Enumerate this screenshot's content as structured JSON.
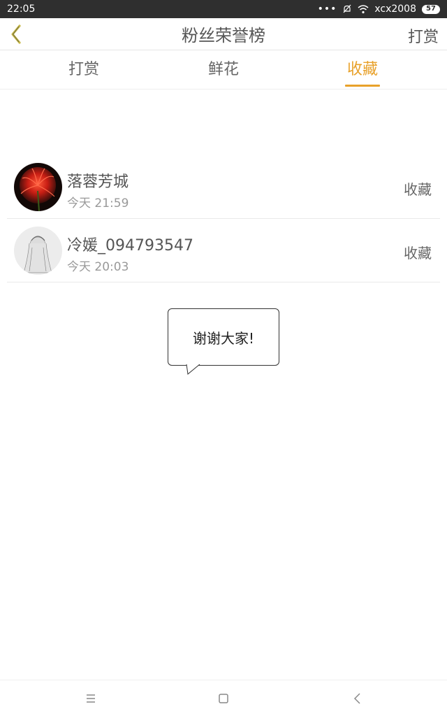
{
  "status_bar": {
    "time": "22:05",
    "dots": "•••",
    "bell_icon": "bell-off-icon",
    "wifi_icon": "wifi-icon",
    "network_name": "xcx2008",
    "battery": "57"
  },
  "header": {
    "title": "粉丝荣誉榜",
    "action_label": "打赏",
    "back_icon": "chevron-left-icon",
    "accent_color": "#c9b94a"
  },
  "tabs": [
    {
      "label": "打赏",
      "active": false
    },
    {
      "label": "鲜花",
      "active": false
    },
    {
      "label": "收藏",
      "active": true
    }
  ],
  "tab_active_color": "#e8a12a",
  "list": [
    {
      "name": "落蓉芳城",
      "time": "今天 21:59",
      "action": "收藏",
      "avatar": "red-flower-avatar"
    },
    {
      "name": "冷媛_094793547",
      "time": "今天 20:03",
      "action": "收藏",
      "avatar": "sketch-portrait-avatar"
    }
  ],
  "bubble": {
    "text": "谢谢大家!"
  },
  "nav_bar": {
    "menu_icon": "menu-icon",
    "home_icon": "home-square-icon",
    "back_icon": "back-triangle-icon"
  }
}
